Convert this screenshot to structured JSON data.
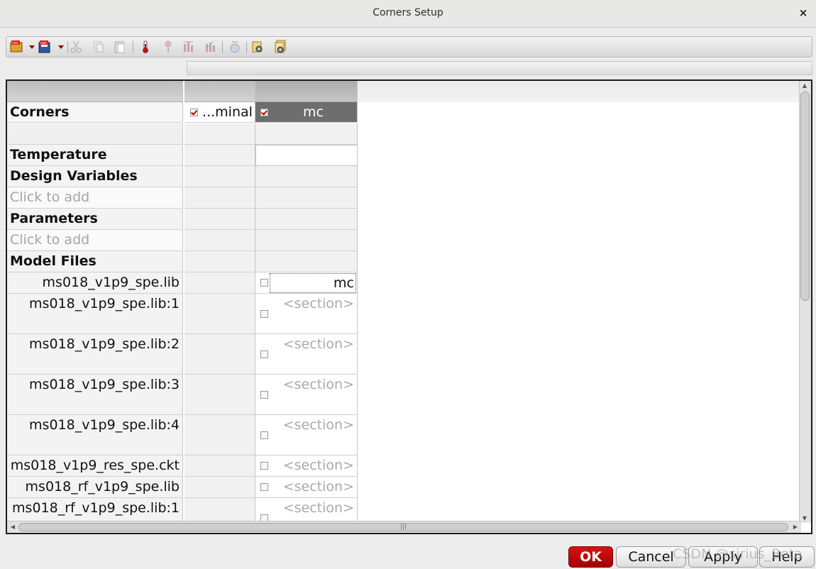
{
  "window": {
    "title": "Corners Setup",
    "close_glyph": "×"
  },
  "toolbar": {
    "icons": [
      "csv-open-icon",
      "csv-save-icon",
      "cut-icon",
      "copy-icon",
      "paste-icon",
      "temperature-icon",
      "parameter-icon",
      "add-variable-icon",
      "remove-variable-icon",
      "sweep-icon",
      "settings-icon",
      "settings-export-icon"
    ]
  },
  "table": {
    "header_row": [
      "",
      "",
      ""
    ],
    "corners_label": "Corners",
    "corners": [
      {
        "name": "...minal",
        "checked": true
      },
      {
        "name": "mc",
        "checked": true
      }
    ],
    "rows": [
      {
        "label": "",
        "type": "spacer"
      },
      {
        "label": "Temperature",
        "type": "section"
      },
      {
        "label": "Design Variables",
        "type": "section"
      },
      {
        "label": "Click to add",
        "type": "add"
      },
      {
        "label": "Parameters",
        "type": "section"
      },
      {
        "label": "Click to add",
        "type": "add"
      },
      {
        "label": "Model Files",
        "type": "section"
      }
    ],
    "model_files": [
      {
        "name": "ms018_v1p9_spe.lib",
        "value": "mc"
      },
      {
        "name": "ms018_v1p9_spe.lib:1",
        "value": "<section>"
      },
      {
        "name": "ms018_v1p9_spe.lib:2",
        "value": "<section>"
      },
      {
        "name": "ms018_v1p9_spe.lib:3",
        "value": "<section>"
      },
      {
        "name": "ms018_v1p9_spe.lib:4",
        "value": "<section>"
      },
      {
        "name": "ms018_v1p9_res_spe.ckt",
        "value": "<section>"
      },
      {
        "name": "ms018_rf_v1p9_spe.lib",
        "value": "<section>"
      },
      {
        "name": "ms018_rf_v1p9_spe.lib:1",
        "value": "<section>"
      }
    ]
  },
  "buttons": {
    "ok": "OK",
    "cancel": "Cancel",
    "apply": "Apply",
    "help": "Help"
  },
  "watermark": "CSDN @sirius_Beta",
  "colors": {
    "ok_button": "#c00000",
    "selected_column": "#6e6e6e",
    "check": "#c00000"
  }
}
